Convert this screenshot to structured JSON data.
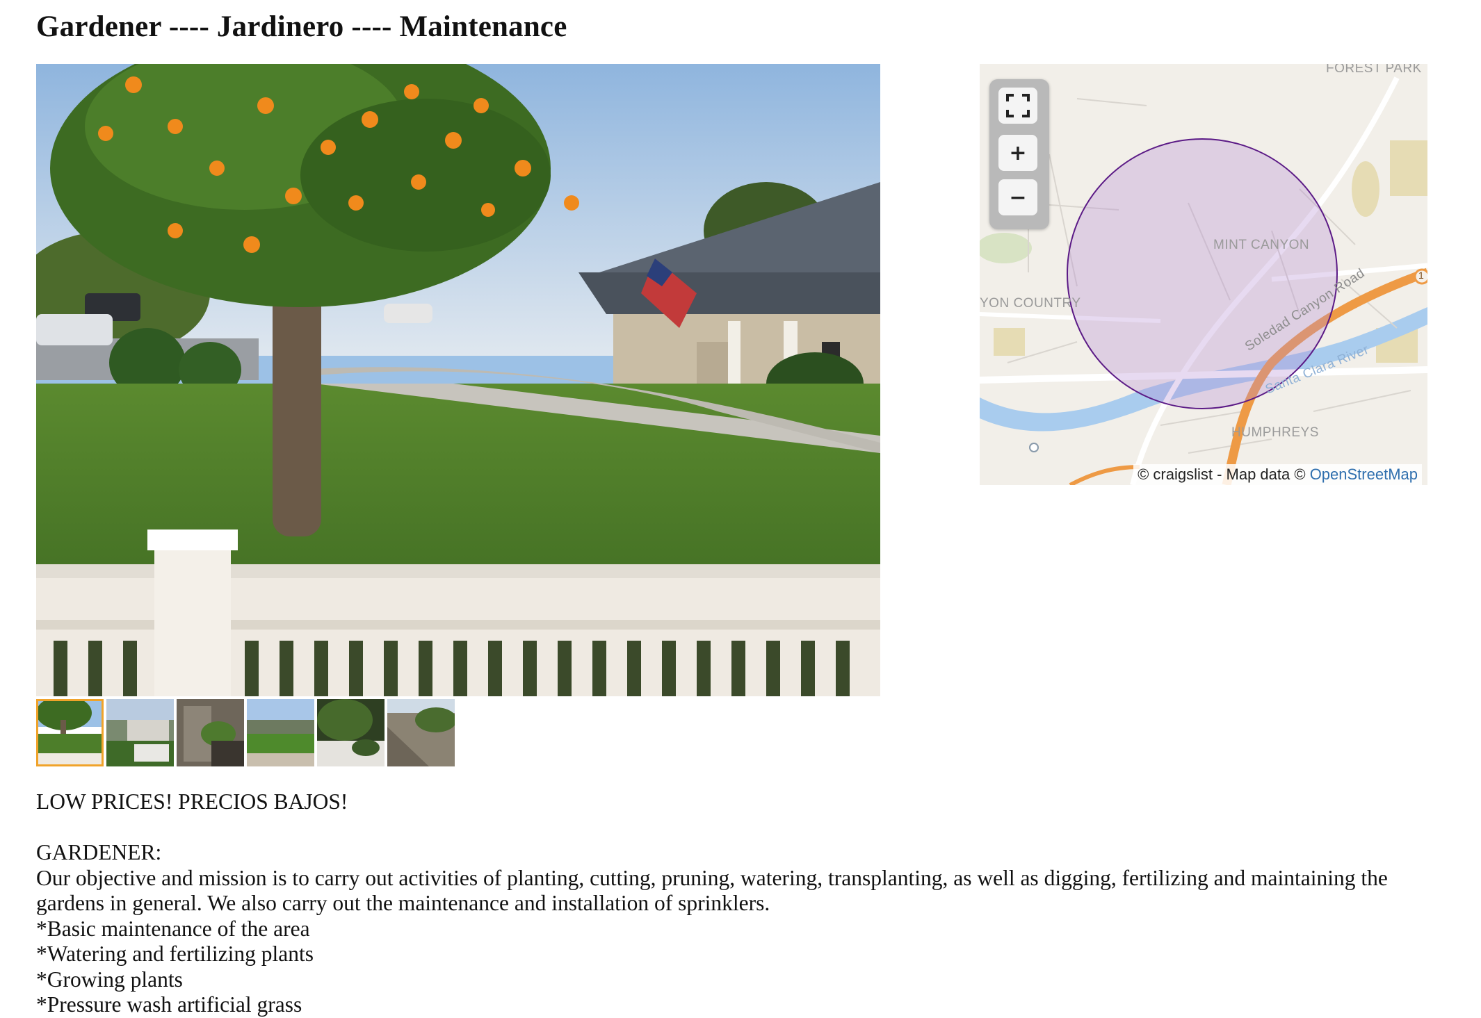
{
  "posting": {
    "title": "Gardener ---- Jardinero ---- Maintenance",
    "body": {
      "headline": "LOW PRICES! PRECIOS BAJOS!",
      "section_heading": "GARDENER:",
      "paragraph": "Our objective and mission is to carry out activities of planting, cutting, pruning, watering, transplanting, as well as digging, fertilizing and maintaining the gardens in general. We also carry out the maintenance and installation of sprinklers.",
      "items": [
        "*Basic maintenance of the area",
        "*Watering and fertilizing plants",
        "*Growing plants",
        "*Pressure wash artificial grass"
      ]
    }
  },
  "gallery": {
    "main_image": "front-yard-lawn-orange-tree-white-fence",
    "thumbnails": [
      {
        "subject": "front-yard-lawn",
        "active": true
      },
      {
        "subject": "yard-with-gravel",
        "active": false
      },
      {
        "subject": "plants-in-rocks",
        "active": false
      },
      {
        "subject": "mowed-lawn",
        "active": false
      },
      {
        "subject": "garden-bed",
        "active": false
      },
      {
        "subject": "hillside-wall",
        "active": false
      }
    ],
    "accent_color": "#f0a32a"
  },
  "map": {
    "labels": {
      "forest_park": "FOREST PARK",
      "mint_canyon": "MINT CANYON",
      "canyon_country": "YON COUNTRY",
      "soledad": "Soledad Canyon Road",
      "river": "Santa Clara River",
      "humphreys": "HUMPHREYS",
      "route": "1"
    },
    "attribution": "© craigslist - Map data ©",
    "attribution_link": "OpenStreetMap",
    "controls": {
      "fullscreen_icon": "fullscreen-icon",
      "zoom_in": "+",
      "zoom_out": "−"
    },
    "circle_color": "#5b1a86"
  }
}
